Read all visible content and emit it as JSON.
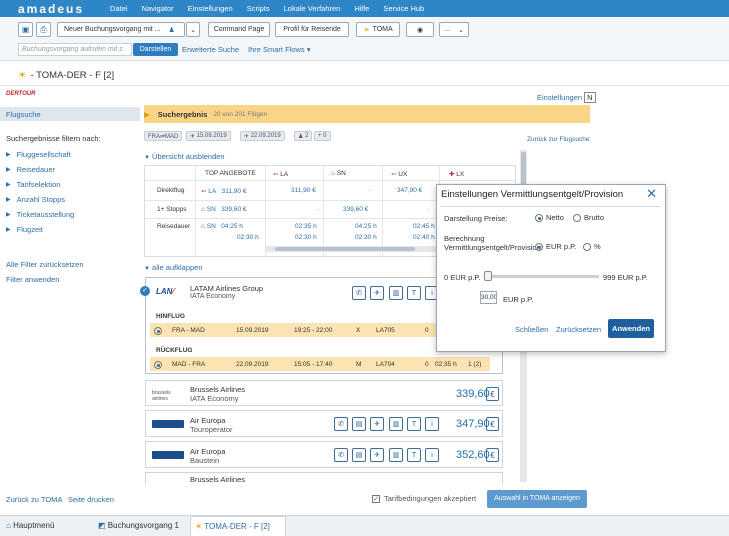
{
  "topbar": {
    "logo": "amadeus",
    "menu": [
      "Datei",
      "Navigator",
      "Einstellungen",
      "Scripts",
      "Lokale Verfahren",
      "Hilfe",
      "Service Hub"
    ]
  },
  "toolbar": {
    "new_booking": "Neuer Buchungsvorgang mit ...",
    "command_page": "Command Page",
    "traveler_profile": "Profil für Reisende",
    "toma": "TOMA",
    "dropdown_value": "...",
    "search_placeholder": "Buchungsvorgang aufrufen mit z.",
    "display": "Darstellen",
    "advanced_search": "Erweiterte Suche",
    "smart_flows": "Ihre Smart Flows ▾"
  },
  "page": {
    "title": "- TOMA-DER - F [2]",
    "brand": "DERTOUR",
    "settings": "Einstellungen",
    "settings_key": "N"
  },
  "sidebar": {
    "header": "Flugsuche",
    "filter_title": "Suchergebnisse filtern nach:",
    "filters": [
      "Fluggesellschaft",
      "Reisedauer",
      "Tarifselektion",
      "Anzahl Stopps",
      "Ticketausstellung",
      "Flugzeit"
    ],
    "reset": "Alle Filter zurücksetzen",
    "apply": "Filter anwenden"
  },
  "results": {
    "label": "Suchergebnis",
    "count": "20 von 201 Flügen",
    "back": "Zurück zur Flugsuche",
    "chips": [
      "FRA⇌MAD",
      "15.09.2019",
      "22.09.2019",
      "2",
      "0"
    ],
    "overview_toggle": "Übersicht ausblenden",
    "expand_all": "alle aufklappen"
  },
  "matrix": {
    "top": "TOP ANGEBOTE",
    "cols": [
      "LA",
      "SN",
      "UX",
      "LX"
    ],
    "rows": [
      {
        "label": "Direktflug",
        "top_code": "LA",
        "top_price": "311,90 €",
        "vals": [
          "311,90 €",
          "-",
          "347,90 €",
          ""
        ]
      },
      {
        "label": "1+ Stopps",
        "top_code": "SN",
        "top_price": "339,60 €",
        "vals": [
          "-",
          "339,60 €",
          "-",
          ""
        ]
      },
      {
        "label": "Reisedauer",
        "top_code": "SN",
        "top_price": "04:25 h",
        "top_price2": "02:30 h",
        "vals": [
          "02:35 h",
          "04:25 h",
          "02:45 h",
          ""
        ],
        "vals2": [
          "02:30 h",
          "02:30 h",
          "02:40 h",
          ""
        ]
      }
    ]
  },
  "offers": [
    {
      "airline": "LATAM Airlines Group",
      "class": "IATA Economy",
      "outbound_label": "HINFLUG",
      "return_label": "RÜCKFLUG",
      "outbound": {
        "route": "FRA - MAD",
        "date": "15.09.2019",
        "time": "19:25 - 22:00",
        "cls": "X",
        "flight": "LA705",
        "stops": "0"
      },
      "return": {
        "route": "MAD - FRA",
        "date": "22.09.2019",
        "time": "15:05 - 17:40",
        "cls": "M",
        "flight": "LA704",
        "stops": "0",
        "duration": "02:35 h",
        "extra": "1 (2)"
      }
    },
    {
      "airline": "Brussels Airlines",
      "class": "IATA Economy",
      "price": "339,60"
    },
    {
      "airline": "Air Europa",
      "class": "Touroperator",
      "price": "347,90"
    },
    {
      "airline": "Air Europa",
      "class": "Baustein",
      "price": "352,60"
    },
    {
      "airline": "Brussels Airlines",
      "class": ""
    }
  ],
  "popup": {
    "title": "Einstellungen Vermittlungsentgelt/Provision",
    "show_prices": "Darstellung Preise:",
    "net": "Netto",
    "gross": "Brutto",
    "calc_line1": "Berechnung",
    "calc_line2": "Vermittlungsentgelt/Provision:",
    "eur": "EUR p.P.",
    "pct": "%",
    "min": "0 EUR p.P.",
    "max": "999 EUR p.P.",
    "value": "30,00",
    "unit": "EUR p.P.",
    "close": "Schließen",
    "reset": "Zurücksetzen",
    "apply": "Anwenden"
  },
  "footer": {
    "back_toma": "Zurück zu TOMA",
    "print": "Seite drucken",
    "terms": "Tarifbedingungen akzeptiert",
    "show": "Auswahl in TOMA anzeigen"
  },
  "tabs": [
    "Hauptmenü",
    "Buchungsvorgang 1",
    "TOMA-DER - F [2]"
  ],
  "colors": {
    "accent": "#2e86c6",
    "highlight": "#fbd587",
    "button": "#2e7dc0"
  }
}
